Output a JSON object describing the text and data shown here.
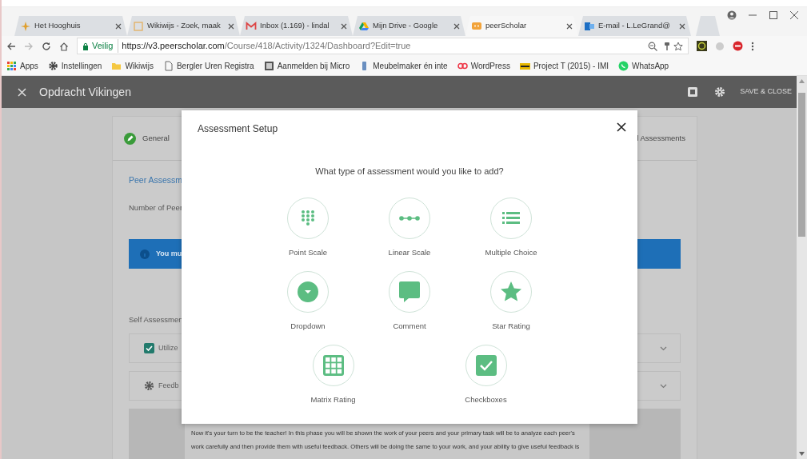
{
  "browser": {
    "tabs": [
      {
        "title": "Het Hooghuis",
        "kind": "star",
        "selected": false
      },
      {
        "title": "Wikiwijs - Zoek, maak",
        "kind": "page",
        "selected": false
      },
      {
        "title": "Inbox (1.169) - lindal",
        "kind": "mail",
        "selected": false
      },
      {
        "title": "Mijn Drive - Google",
        "kind": "drive",
        "selected": false
      },
      {
        "title": "peerScholar",
        "kind": "chat",
        "selected": true
      },
      {
        "title": "E-mail - L.LeGrand@",
        "kind": "outlook",
        "selected": false
      }
    ],
    "address_bar": {
      "security": "Veilig",
      "host": "https://v3.peerscholar.com",
      "path": "/Course/418/Activity/1324/Dashboard?Edit=true"
    },
    "bookmarks": [
      {
        "label": "Apps",
        "kind": "apps"
      },
      {
        "label": "Instellingen",
        "kind": "gear"
      },
      {
        "label": "Wikiwijs",
        "kind": "folder"
      },
      {
        "label": "Bergler Uren Registra",
        "kind": "page"
      },
      {
        "label": "Aanmelden bij Micro",
        "kind": "image"
      },
      {
        "label": "Meubelmaker én inte",
        "kind": "tool"
      },
      {
        "label": "WordPress",
        "kind": "dots"
      },
      {
        "label": "Project T (2015) - IMI",
        "kind": "film"
      },
      {
        "label": "WhatsApp",
        "kind": "whatsapp"
      }
    ]
  },
  "app": {
    "title": "Opdracht Vikingen",
    "action": "SAVE & CLOSE"
  },
  "background": {
    "steps": [
      {
        "label": "General",
        "done": true
      },
      {
        "label": "l Assessments"
      }
    ],
    "section_title": "Peer Assessm",
    "field_label": "Number of Peer",
    "alert": "You mu",
    "self_label": "Self Assessmen",
    "options": [
      {
        "kind": "checkbox",
        "label": "Utilize",
        "checked": true
      },
      {
        "kind": "settings",
        "label": "Feedb"
      }
    ],
    "paragraph": "Now it's your turn to be the teacher! In this phase you will be shown the work of your peers and your primary task will be to analyze each peer's work carefully and then provide them with useful feedback. Others will be doing the same to your work, and your ability to give useful feedback is"
  },
  "modal": {
    "title": "Assessment Setup",
    "question": "What type of assessment would you like to add?",
    "rows": [
      [
        {
          "label": "Point Scale",
          "kind": "point-scale"
        },
        {
          "label": "Linear Scale",
          "kind": "linear-scale"
        },
        {
          "label": "Multiple Choice",
          "kind": "multiple-choice"
        }
      ],
      [
        {
          "label": "Dropdown",
          "kind": "dropdown"
        },
        {
          "label": "Comment",
          "kind": "comment"
        },
        {
          "label": "Star Rating",
          "kind": "star"
        }
      ],
      [
        {
          "label": "Matrix Rating",
          "kind": "matrix"
        },
        {
          "label": "Checkboxes",
          "kind": "checkboxes"
        }
      ]
    ]
  }
}
